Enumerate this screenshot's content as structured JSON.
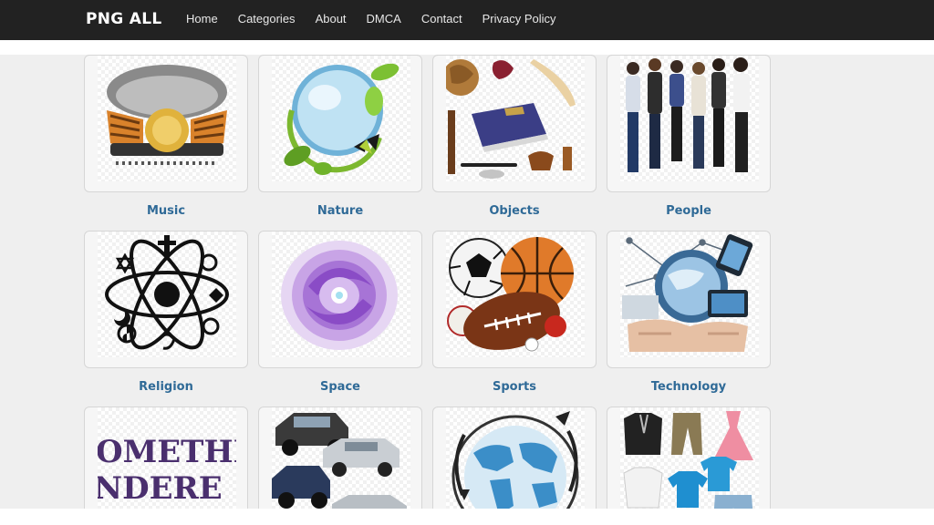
{
  "site": {
    "brand": "PNG ALL"
  },
  "nav": {
    "items": [
      {
        "label": "Home"
      },
      {
        "label": "Categories"
      },
      {
        "label": "About"
      },
      {
        "label": "DMCA"
      },
      {
        "label": "Contact"
      },
      {
        "label": "Privacy Policy"
      }
    ]
  },
  "categories": [
    {
      "label": "Music",
      "icon": "music-icon"
    },
    {
      "label": "Nature",
      "icon": "nature-icon"
    },
    {
      "label": "Objects",
      "icon": "objects-icon"
    },
    {
      "label": "People",
      "icon": "people-icon"
    },
    {
      "label": "Religion",
      "icon": "religion-icon"
    },
    {
      "label": "Space",
      "icon": "space-icon"
    },
    {
      "label": "Sports",
      "icon": "sports-icon"
    },
    {
      "label": "Technology",
      "icon": "technology-icon"
    },
    {
      "label": "",
      "icon": "text-icon",
      "thumb_text_1": "OMETHIN",
      "thumb_text_2": "NDERE"
    },
    {
      "label": "",
      "icon": "vehicles-icon"
    },
    {
      "label": "",
      "icon": "globe-icon"
    },
    {
      "label": "",
      "icon": "clothing-icon"
    }
  ],
  "colors": {
    "topbar": "#222222",
    "link": "#2f6a97",
    "background": "#efefef"
  }
}
